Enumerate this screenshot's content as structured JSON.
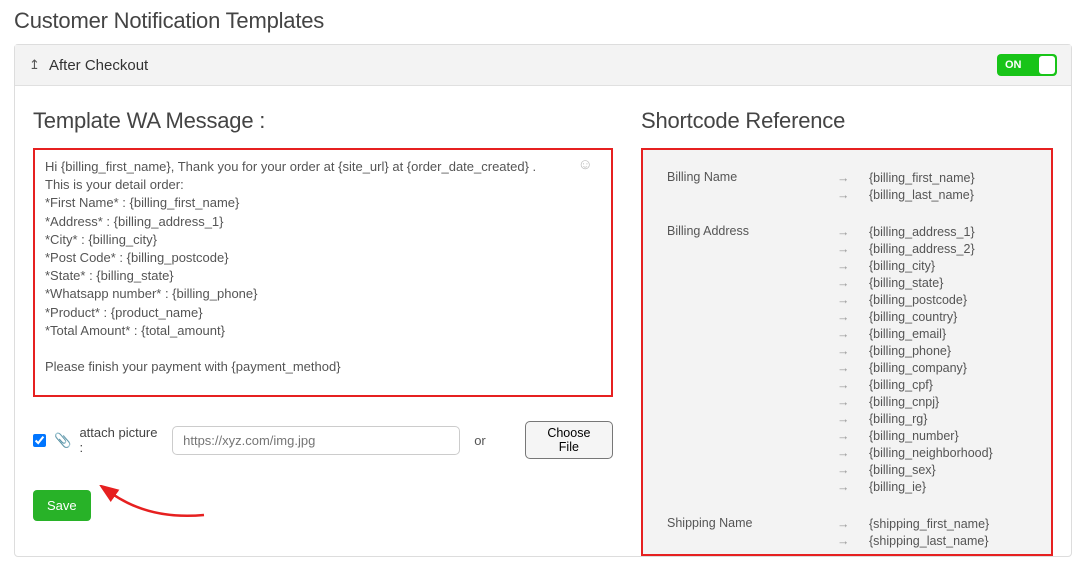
{
  "page_title": "Customer Notification Templates",
  "accordion": {
    "title": "After Checkout",
    "toggle_label": "ON"
  },
  "template": {
    "title": "Template WA Message :",
    "message": "Hi {billing_first_name}, Thank you for your order at {site_url} at {order_date_created} .\nThis is your detail order:\n*First Name* : {billing_first_name}\n*Address* : {billing_address_1}\n*City* : {billing_city}\n*Post Code* : {billing_postcode}\n*State* : {billing_state}\n*Whatsapp number* : {billing_phone}\n*Product* : {product_name}\n*Total Amount* : {total_amount}\n\nPlease finish your payment with {payment_method}",
    "attach_label": "attach picture :",
    "url_placeholder": "https://xyz.com/img.jpg",
    "or_label": "or",
    "choose_file_label": "Choose File",
    "save_label": "Save"
  },
  "reference": {
    "title": "Shortcode Reference",
    "groups": [
      {
        "label": "Billing Name",
        "codes": [
          "{billing_first_name}",
          "{billing_last_name}"
        ]
      },
      {
        "label": "Billing Address",
        "codes": [
          "{billing_address_1}",
          "{billing_address_2}",
          "{billing_city}",
          "{billing_state}",
          "{billing_postcode}",
          "{billing_country}",
          "{billing_email}",
          "{billing_phone}",
          "{billing_company}",
          "{billing_cpf}",
          "{billing_cnpj}",
          "{billing_rg}",
          "{billing_number}",
          "{billing_neighborhood}",
          "{billing_sex}",
          "{billing_ie}"
        ]
      },
      {
        "label": "Shipping Name",
        "codes": [
          "{shipping_first_name}",
          "{shipping_last_name}"
        ]
      }
    ]
  }
}
